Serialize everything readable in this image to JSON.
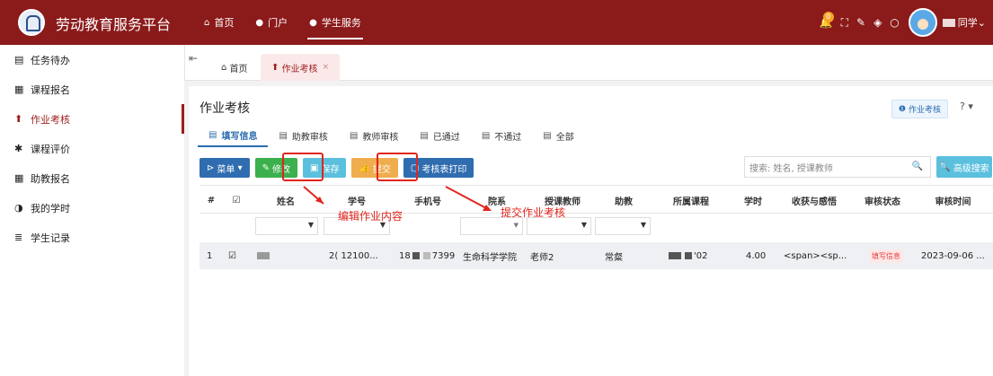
{
  "app": {
    "title": "劳动教育服务平台"
  },
  "topnav": [
    {
      "icon": "home-icon",
      "glyph": "⌂",
      "label": "首页"
    },
    {
      "icon": "portal-icon",
      "glyph": "●",
      "label": "门户"
    },
    {
      "icon": "student-service-icon",
      "glyph": "●",
      "label": "学生服务"
    }
  ],
  "user": {
    "name": "同学",
    "badge": "0"
  },
  "sidebar": [
    {
      "glyph": "▤",
      "label": "任务待办"
    },
    {
      "glyph": "▦",
      "label": "课程报名"
    },
    {
      "glyph": "⬆",
      "label": "作业考核"
    },
    {
      "glyph": "✱",
      "label": "课程评价"
    },
    {
      "glyph": "▦",
      "label": "助教报名"
    },
    {
      "glyph": "◑",
      "label": "我的学时"
    },
    {
      "glyph": "≣",
      "label": "学生记录"
    }
  ],
  "page_tabs": {
    "home": "首页",
    "current": "作业考核",
    "close": "×"
  },
  "page": {
    "title": "作业考核",
    "help_label": "作业考核",
    "help_glyph": "?"
  },
  "subtabs": [
    "填写信息",
    "助教审核",
    "教师审核",
    "已通过",
    "不通过",
    "全部"
  ],
  "toolbar": {
    "menu": "菜单",
    "edit": "修改",
    "save": "保存",
    "submit": "提交",
    "print": "考核表打印"
  },
  "search": {
    "placeholder": "搜索: 姓名, 授课教师",
    "advanced": "高级搜索"
  },
  "table": {
    "columns": [
      "#",
      "☑",
      "姓名",
      "学号",
      "手机号",
      "院系",
      "授课教师",
      "助教",
      "所属课程",
      "学时",
      "收获与感悟",
      "审核状态",
      "审核时间"
    ],
    "row": {
      "index": "1",
      "student_id": "2(  12100...",
      "phone_prefix": "18",
      "phone_suffix": "7399",
      "department": "生命科学学院",
      "teacher": "老师2",
      "assistant": "常粲",
      "course_suffix": "'02",
      "hours": "4.00",
      "reflection": "<span><sp...",
      "status": "填写信息",
      "time": "2023-09-06 ..."
    }
  },
  "annotations": {
    "edit": "编辑作业内容",
    "submit": "提交作业考核"
  },
  "colors": {
    "brand": "#8b1a1a",
    "accent_blue": "#2b6cb0",
    "annotation_red": "#e0261d"
  }
}
